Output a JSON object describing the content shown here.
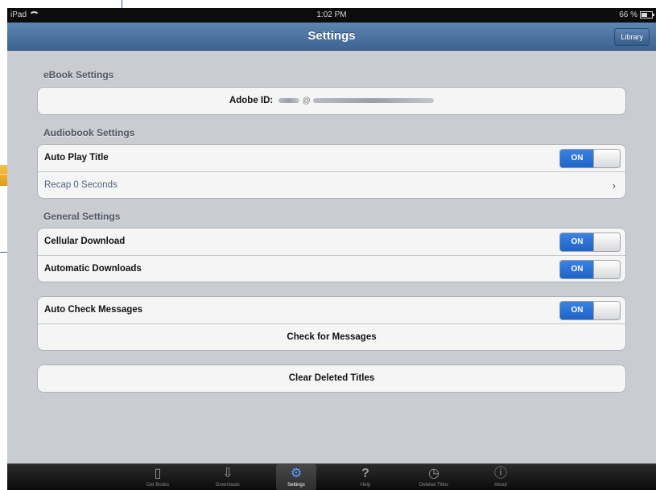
{
  "status_bar": {
    "device": "iPad",
    "time": "1:02 PM",
    "battery": "66 %"
  },
  "nav": {
    "title": "Settings",
    "library_button": "Library"
  },
  "ebook": {
    "header": "eBook Settings",
    "adobe_label": "Adobe ID:",
    "adobe_value_redacted": "@"
  },
  "audiobook": {
    "header": "Audiobook Settings",
    "auto_play_label": "Auto Play Title",
    "auto_play_state": "ON",
    "recap_label": "Recap 0 Seconds"
  },
  "general": {
    "header": "General Settings",
    "cellular_label": "Cellular Download",
    "cellular_state": "ON",
    "auto_download_label": "Automatic Downloads",
    "auto_download_state": "ON"
  },
  "messages": {
    "auto_check_label": "Auto Check Messages",
    "auto_check_state": "ON",
    "check_button": "Check for Messages"
  },
  "clear_button": "Clear Deleted Titles",
  "tabs": [
    {
      "label": "Get Books",
      "icon": "book-icon"
    },
    {
      "label": "Downloads",
      "icon": "download-icon"
    },
    {
      "label": "Settings",
      "icon": "gears-icon",
      "active": true
    },
    {
      "label": "Help",
      "icon": "question-icon"
    },
    {
      "label": "Deleted Titles",
      "icon": "clock-icon"
    },
    {
      "label": "About",
      "icon": "info-icon"
    }
  ],
  "colors": {
    "nav_blue": "#4a70a0",
    "toggle_on": "#2a6fd6",
    "background": "#c9ccd1"
  }
}
